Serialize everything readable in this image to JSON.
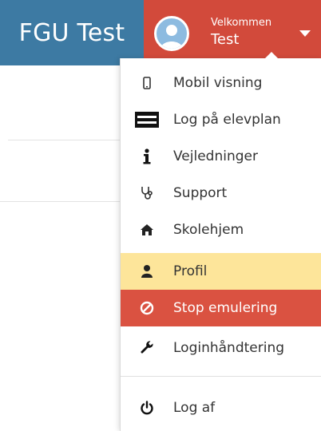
{
  "header": {
    "brand": "FGU Test",
    "welcome": "Velkommen",
    "username": "Test",
    "avatar_icon": "user-avatar-icon",
    "caret_icon": "caret-down-icon"
  },
  "menu": {
    "items": [
      {
        "label": "Mobil visning",
        "icon": "mobile-icon"
      },
      {
        "label": "Log på elevplan",
        "icon": "elevplan-logo-icon"
      },
      {
        "label": "Vejledninger",
        "icon": "info-icon"
      },
      {
        "label": "Support",
        "icon": "stethoscope-icon"
      },
      {
        "label": "Skolehjem",
        "icon": "home-icon"
      },
      {
        "label": "Profil",
        "icon": "user-icon"
      },
      {
        "label": "Stop emulering",
        "icon": "ban-icon"
      },
      {
        "label": "Loginhåndtering",
        "icon": "wrench-icon"
      },
      {
        "label": "Log af",
        "icon": "power-icon"
      }
    ]
  },
  "colors": {
    "brand_bg": "#3d7aa3",
    "user_bg": "#d24a3b",
    "highlight": "#fde59a",
    "stop_bg": "#da5241"
  }
}
